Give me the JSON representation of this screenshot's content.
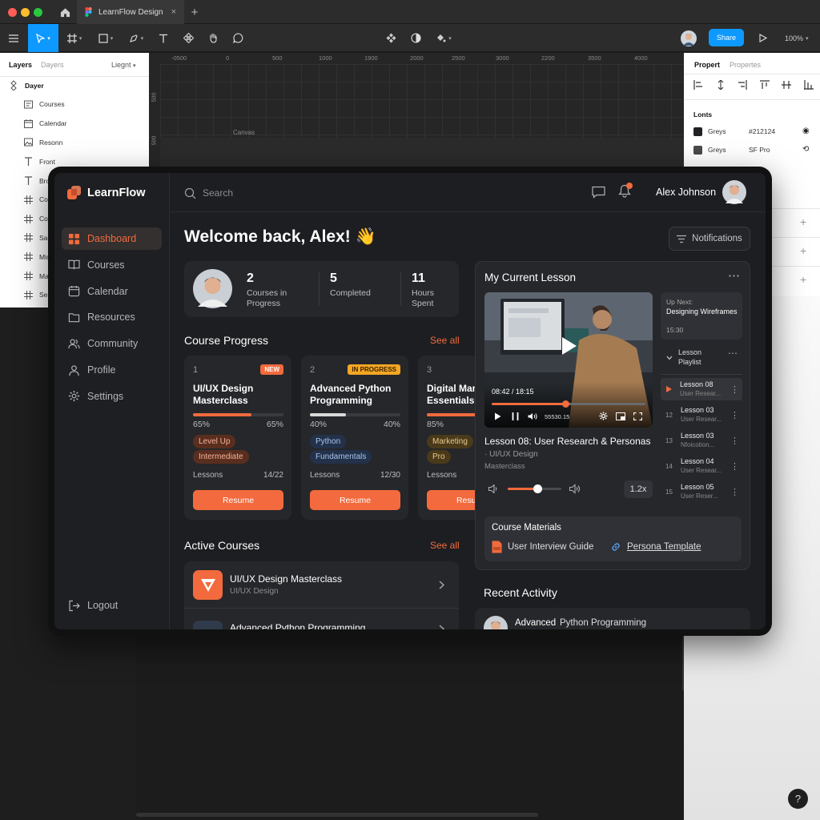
{
  "figma": {
    "file_tab_title": "LearnFlow Design",
    "share_label": "Share",
    "zoom": "100%",
    "left_tabs": {
      "layers": "Layers",
      "dayers": "Dayers",
      "page": "Liegnt"
    },
    "layers": [
      {
        "name": "Dayer",
        "icon": "component-icon"
      },
      {
        "name": "Courses",
        "icon": "frame-icon"
      },
      {
        "name": "Calendar",
        "icon": "calendar-icon"
      },
      {
        "name": "Resonn",
        "icon": "image-icon"
      },
      {
        "name": "Front",
        "icon": "text-icon"
      },
      {
        "name": "Bro",
        "icon": "text-icon"
      },
      {
        "name": "Con",
        "icon": "grid-icon"
      },
      {
        "name": "Con",
        "icon": "grid-icon"
      },
      {
        "name": "Sar",
        "icon": "grid-icon"
      },
      {
        "name": "Mis",
        "icon": "grid-icon"
      },
      {
        "name": "Mar",
        "icon": "grid-icon"
      },
      {
        "name": "Ser",
        "icon": "grid-icon"
      }
    ],
    "ruler_top": [
      "-0500",
      "0",
      "500",
      "1000",
      "1900",
      "2000",
      "2500",
      "3000",
      "2200",
      "3500",
      "4000"
    ],
    "ruler_left": [
      "500",
      "500"
    ],
    "canvas_label": "Canvas",
    "right_tabs": {
      "property": "Propert",
      "properties": "Propertes"
    },
    "fonts_header": "Lonts",
    "styles": [
      {
        "name": "Greys",
        "value": "#212124",
        "swatch": "#212124",
        "action": "eye-icon"
      },
      {
        "name": "Greys",
        "value": "SF Pro",
        "swatch": "#4a4a4a",
        "action": "link-icon"
      }
    ],
    "help": "?"
  },
  "app": {
    "brand": "LearnFlow",
    "accent": "#f26a3d",
    "nav": [
      {
        "label": "Dashboard",
        "icon": "dashboard-icon",
        "active": true
      },
      {
        "label": "Courses",
        "icon": "book-icon",
        "active": false
      },
      {
        "label": "Calendar",
        "icon": "calendar-icon",
        "active": false
      },
      {
        "label": "Resources",
        "icon": "folder-icon",
        "active": false
      },
      {
        "label": "Community",
        "icon": "users-icon",
        "active": false
      },
      {
        "label": "Profile",
        "icon": "user-icon",
        "active": false
      },
      {
        "label": "Settings",
        "icon": "gear-icon",
        "active": false
      }
    ],
    "logout": "Logout",
    "search_placeholder": "Search",
    "user_name": "Alex Johnson",
    "welcome": "Welcome back, Alex! 👋",
    "notifications_label": "Notifications",
    "stats": [
      {
        "value": "2",
        "label": "Courses in Progress"
      },
      {
        "value": "5",
        "label": "Completed"
      },
      {
        "value": "11",
        "label": "Hours Spent"
      }
    ],
    "course_progress_title": "Course Progress",
    "see_all": "See all",
    "progress_cards": [
      {
        "num": "1",
        "badge": "NEW",
        "badge_color": "#f26a3d",
        "title": "UI/UX Design Masterclass",
        "left_pct": "65%",
        "right_pct": "65%",
        "progress": 0.65,
        "bar_color": "#f26a3d",
        "tags": [
          "Level Up",
          "Intermediate"
        ],
        "lessons_label": "Lessons",
        "lessons_count": "14/22",
        "button": "Resume"
      },
      {
        "num": "2",
        "badge": "IN PROGRESS",
        "badge_color": "#f5a623",
        "title": "Advanced Python Programming",
        "left_pct": "40%",
        "right_pct": "40%",
        "progress": 0.4,
        "bar_color": "#d8d8d8",
        "tags": [
          "Python",
          "Fundamentals"
        ],
        "lessons_label": "Lessons",
        "lessons_count": "12/30",
        "button": "Resume"
      },
      {
        "num": "3",
        "badge": "",
        "badge_color": "",
        "title": "Digital Marketing Essentials",
        "left_pct": "85%",
        "right_pct": "",
        "progress": 0.85,
        "bar_color": "#f26a3d",
        "tags": [
          "Marketing",
          "Pro"
        ],
        "lessons_label": "Lessons",
        "lessons_count": "",
        "button": "Resume"
      }
    ],
    "active_courses_title": "Active Courses",
    "active_courses": [
      {
        "title": "UI/UX Design Masterclass",
        "subtitle": "UI/UX Design"
      },
      {
        "title": "Advanced Python Programming",
        "subtitle": ""
      }
    ],
    "lesson": {
      "panel_title": "My Current Lesson",
      "time": "08:42 / 18:15",
      "time_progress": 0.48,
      "extra_time": "55530.15",
      "title": "Lesson 08: User Research & Personas",
      "course": "UI/UX Design",
      "category": "Masterclass",
      "volume": 0.55,
      "speed": "1.2x",
      "up_next_label": "Up Next:",
      "up_next_title": "Designing Wireframes",
      "up_next_time": "15:30",
      "playlist_label": "Lesson Playlist",
      "playlist": [
        {
          "num": "",
          "title": "Lesson 08",
          "sub": "User Resear...",
          "current": true
        },
        {
          "num": "12",
          "title": "Lesson 03",
          "sub": "User Resear...",
          "current": false
        },
        {
          "num": "13",
          "title": "Lesson 03",
          "sub": "Nfoicotion...",
          "current": false
        },
        {
          "num": "14",
          "title": "Lesson 04",
          "sub": "User Resear...",
          "current": false
        },
        {
          "num": "15",
          "title": "Lesson 05",
          "sub": "User Reser...",
          "current": false
        }
      ],
      "materials_title": "Course Materials",
      "materials": [
        {
          "label": "User Interview Guide",
          "icon": "pdf-icon"
        },
        {
          "label": "Persona Template",
          "icon": "link-icon"
        }
      ]
    },
    "recent_activity_title": "Recent Activity",
    "recent_activity": [
      {
        "title": "Advanced",
        "course": "Python Programming"
      }
    ]
  }
}
